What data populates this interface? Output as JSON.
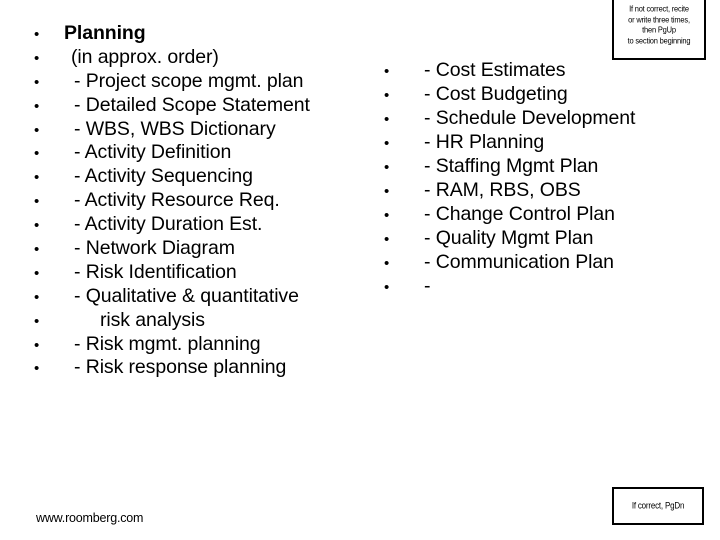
{
  "slide": {
    "bullet_glyph": "•",
    "left_column": [
      {
        "marker": "•",
        "text": "Planning",
        "style": "bold",
        "indent": 0
      },
      {
        "marker": "•",
        "text": "(in approx. order)",
        "style": "normal",
        "indent": 1
      },
      {
        "marker": "•",
        "text": "- Project scope mgmt. plan",
        "style": "normal",
        "indent": 2
      },
      {
        "marker": "•",
        "text": "- Detailed Scope Statement",
        "style": "normal",
        "indent": 2
      },
      {
        "marker": "•",
        "text": "- WBS, WBS Dictionary",
        "style": "normal",
        "indent": 2
      },
      {
        "marker": "•",
        "text": "- Activity Definition",
        "style": "normal",
        "indent": 2
      },
      {
        "marker": "•",
        "text": "- Activity Sequencing",
        "style": "normal",
        "indent": 2
      },
      {
        "marker": "•",
        "text": "- Activity Resource Req.",
        "style": "normal",
        "indent": 2
      },
      {
        "marker": "•",
        "text": "- Activity Duration Est.",
        "style": "normal",
        "indent": 2
      },
      {
        "marker": "•",
        "text": "- Network Diagram",
        "style": "normal",
        "indent": 2
      },
      {
        "marker": "•",
        "text": "- Risk Identification",
        "style": "normal",
        "indent": 2
      },
      {
        "marker": "•",
        "text": "- Qualitative & quantitative",
        "style": "normal",
        "indent": 2
      },
      {
        "marker": "•",
        "text": "risk analysis",
        "style": "normal",
        "indent": 3
      },
      {
        "marker": "•",
        "text": "- Risk mgmt. planning",
        "style": "normal",
        "indent": 2
      },
      {
        "marker": "•",
        "text": "- Risk response planning",
        "style": "normal",
        "indent": 2
      }
    ],
    "right_column": [
      {
        "marker": "•",
        "text": "- Cost Estimates"
      },
      {
        "marker": "•",
        "text": "- Cost Budgeting"
      },
      {
        "marker": "•",
        "text": "- Schedule Development"
      },
      {
        "marker": "•",
        "text": "- HR Planning"
      },
      {
        "marker": "•",
        "text": "- Staffing Mgmt Plan"
      },
      {
        "marker": "•",
        "text": "- RAM, RBS, OBS"
      },
      {
        "marker": "•",
        "text": "- Change Control Plan"
      },
      {
        "marker": "•",
        "text": "- Quality Mgmt Plan"
      },
      {
        "marker": "•",
        "text": "- Communication Plan"
      },
      {
        "marker": "•",
        "text": "-"
      }
    ],
    "note_top": {
      "lines": [
        "If not correct, recite",
        "or write three times,",
        "then PgUp",
        "to section beginning"
      ]
    },
    "note_bottom": {
      "lines": [
        "If correct, PgDn"
      ]
    },
    "footer": "www.roomberg.com"
  }
}
